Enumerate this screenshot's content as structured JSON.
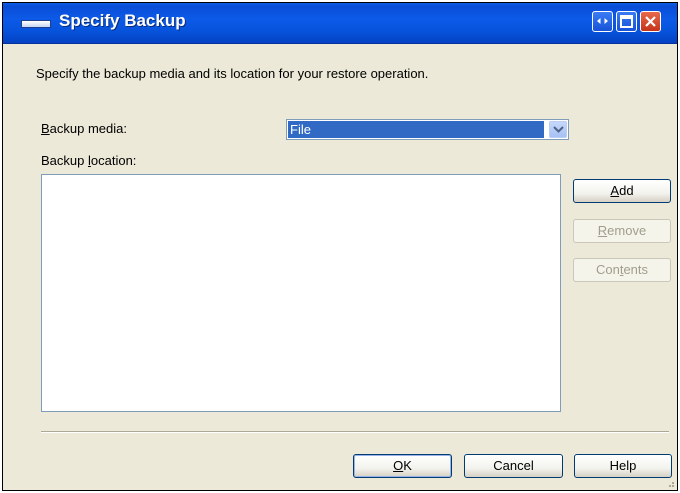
{
  "window": {
    "title": "Specify Backup",
    "buttons": [
      "restore-down",
      "maximize",
      "close"
    ]
  },
  "description": "Specify the backup media and its location for your restore operation.",
  "backup_media": {
    "label_accel": "B",
    "label_rest": "ackup media:",
    "value": "File"
  },
  "backup_location": {
    "label_pre": "Backup ",
    "label_accel": "l",
    "label_rest": "ocation:",
    "items": []
  },
  "side_buttons": {
    "add": {
      "accel": "A",
      "rest": "dd",
      "enabled": true
    },
    "remove": {
      "accel": "R",
      "rest": "emove",
      "enabled": false
    },
    "contents_pre": "Con",
    "contents_accel": "t",
    "contents_rest": "ents",
    "contents_enabled": false
  },
  "footer_buttons": {
    "ok_accel": "O",
    "ok_rest": "K",
    "cancel": "Cancel",
    "help": "Help"
  },
  "colors": {
    "titlebar": "#0a4dd6",
    "dialog_bg": "#ece9d8",
    "selection": "#316ac5"
  }
}
